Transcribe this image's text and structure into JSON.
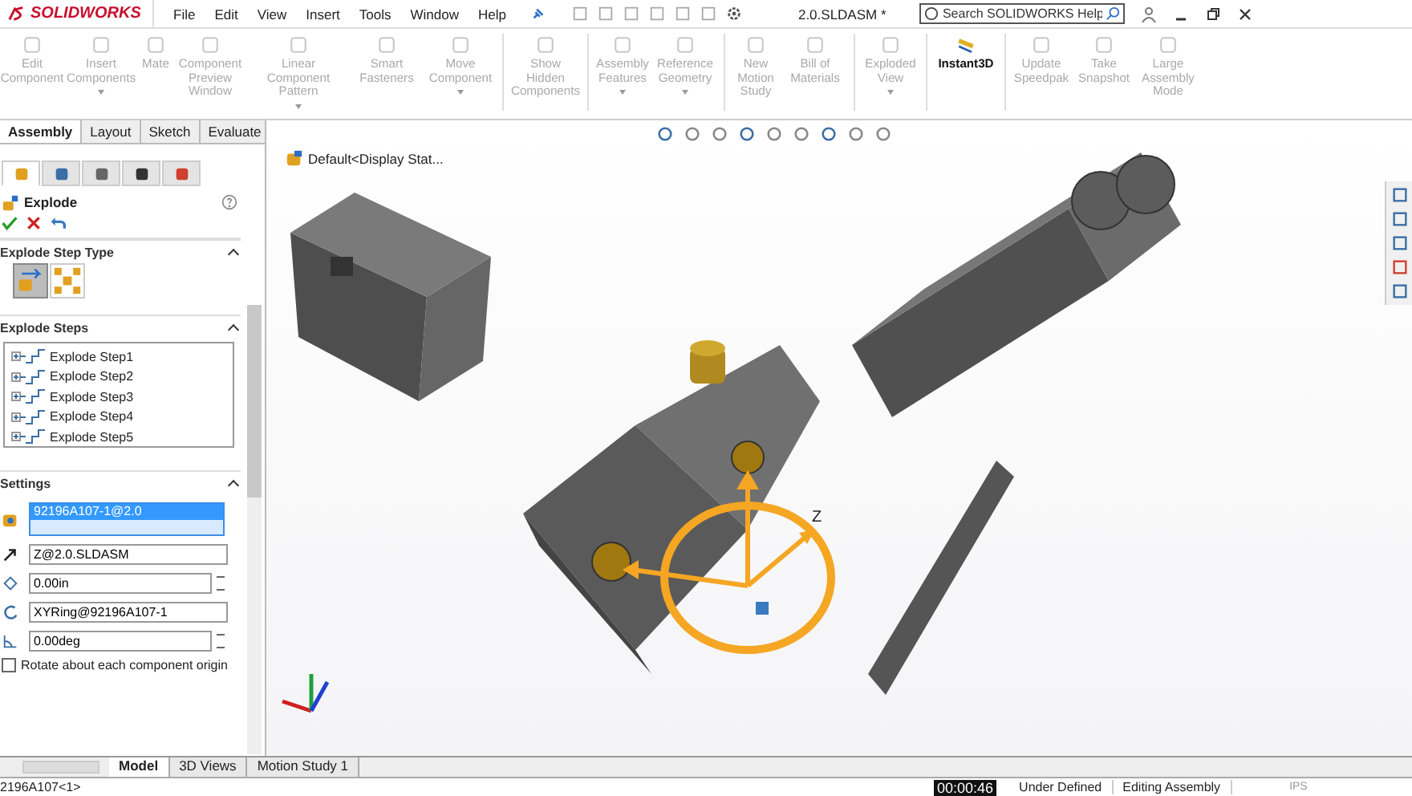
{
  "title_bar": {
    "logo": "SOLIDWORKS",
    "menu": [
      "File",
      "Edit",
      "View",
      "Insert",
      "Tools",
      "Window",
      "Help"
    ],
    "document_title": "2.0.SLDASM *",
    "search": {
      "placeholder": "Search SOLIDWORKS Help"
    }
  },
  "ribbon": {
    "groups": [
      {
        "tools": [
          {
            "label": "Edit Component",
            "disabled": true,
            "dropdown": false
          },
          {
            "label": "Insert Components",
            "disabled": true,
            "dropdown": true
          },
          {
            "label": "Mate",
            "disabled": true,
            "dropdown": false
          },
          {
            "label": "Component Preview Window",
            "disabled": true,
            "dropdown": false
          },
          {
            "label": "Linear Component Pattern",
            "disabled": true,
            "dropdown": true
          },
          {
            "label": "Smart Fasteners",
            "disabled": true,
            "dropdown": false
          },
          {
            "label": "Move Component",
            "disabled": true,
            "dropdown": true
          }
        ]
      },
      {
        "tools": [
          {
            "label": "Show Hidden Components",
            "disabled": true,
            "dropdown": false
          }
        ]
      },
      {
        "tools": [
          {
            "label": "Assembly Features",
            "disabled": true,
            "dropdown": true
          },
          {
            "label": "Reference Geometry",
            "disabled": true,
            "dropdown": true
          }
        ]
      },
      {
        "tools": [
          {
            "label": "New Motion Study",
            "disabled": true,
            "dropdown": false
          },
          {
            "label": "Bill of Materials",
            "disabled": true,
            "dropdown": false
          }
        ]
      },
      {
        "tools": [
          {
            "label": "Exploded View",
            "disabled": true,
            "dropdown": true
          }
        ]
      },
      {
        "tools": [
          {
            "label": "Instant3D",
            "disabled": false,
            "dropdown": false
          }
        ]
      },
      {
        "tools": [
          {
            "label": "Update Speedpak",
            "disabled": true,
            "dropdown": false
          },
          {
            "label": "Take Snapshot",
            "disabled": true,
            "dropdown": false
          },
          {
            "label": "Large Assembly Mode",
            "disabled": true,
            "dropdown": false
          }
        ]
      }
    ]
  },
  "command_tabs": [
    {
      "label": "Assembly",
      "selected": true
    },
    {
      "label": "Layout",
      "selected": false
    },
    {
      "label": "Sketch",
      "selected": false
    },
    {
      "label": "Evaluate",
      "selected": false
    }
  ],
  "manager_tabs": [
    {
      "selected": true
    },
    {
      "selected": false
    },
    {
      "selected": false
    },
    {
      "selected": false
    },
    {
      "selected": false
    }
  ],
  "property_manager": {
    "title": "Explode",
    "step_type": {
      "title": "Explode Step Type",
      "types": [
        {
          "selected": true
        },
        {
          "selected": false
        }
      ]
    },
    "steps": {
      "title": "Explode Steps",
      "items": [
        "Explode Step1",
        "Explode Step2",
        "Explode Step3",
        "Explode Step4",
        "Explode Step5"
      ]
    },
    "settings": {
      "title": "Settings",
      "component": "92196A107-1@2.0",
      "direction": "Z@2.0.SLDASM",
      "distance": "0.00in",
      "rotation_axis": "XYRing@92196A107-1",
      "angle": "0.00deg",
      "rotate_option": {
        "label": "Rotate about each component origin",
        "checked": false
      }
    }
  },
  "viewport": {
    "tree_item": "Default<Display Stat...",
    "manipulator_label": "Z"
  },
  "bottom_tabs": [
    {
      "label": "Model",
      "selected": true
    },
    {
      "label": "3D Views",
      "selected": false
    },
    {
      "label": "Motion Study 1",
      "selected": false
    }
  ],
  "status_bar": {
    "component": "2196A107<1>",
    "timestamp": "00:00:46",
    "items": [
      "Under Defined",
      "Editing Assembly"
    ],
    "units": "IPS"
  }
}
